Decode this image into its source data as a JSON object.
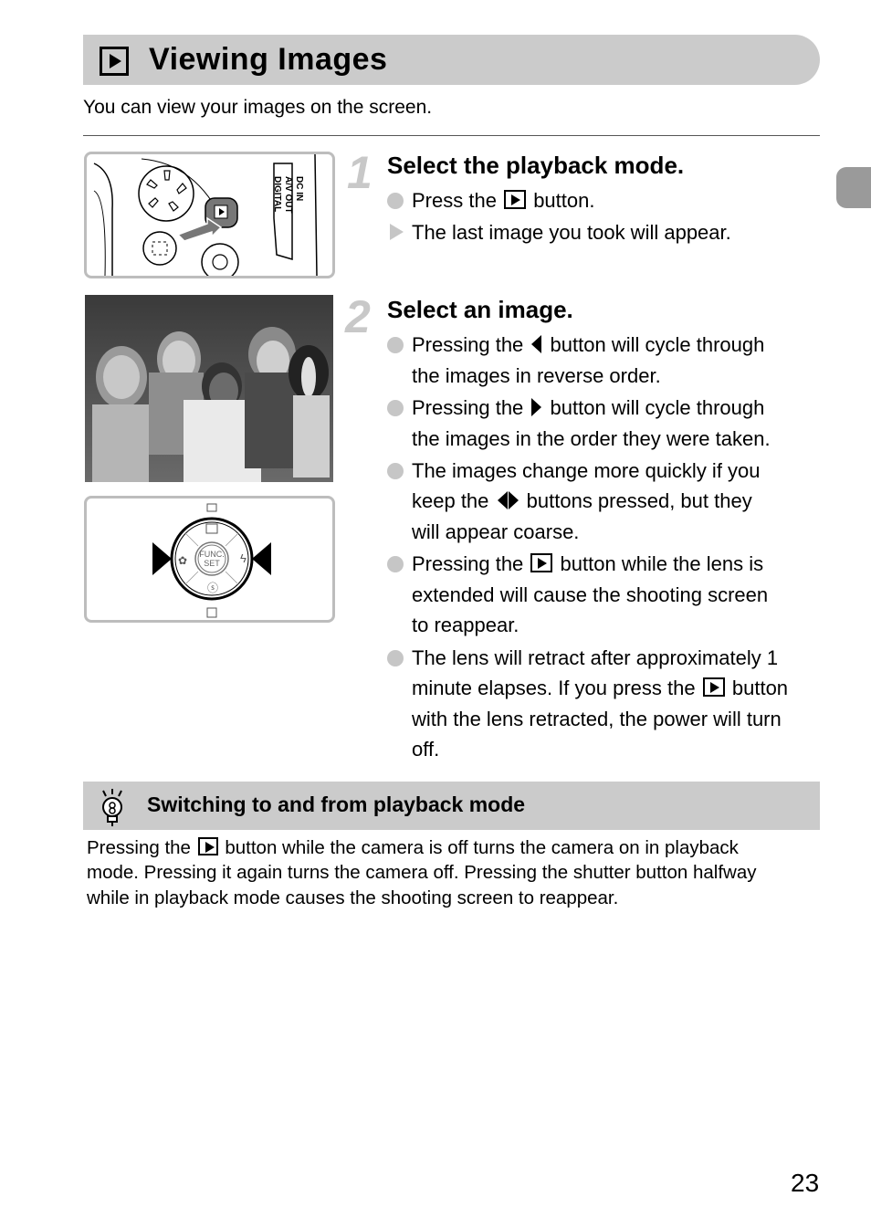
{
  "header": {
    "icon": "playback-icon",
    "title": "Viewing Images",
    "intro": "You can view your images on the screen."
  },
  "figures": {
    "camera_back": {
      "description": "Camera back with arrow pointing at playback button",
      "port_label": [
        "DC IN",
        "A/V OUT",
        "DIGITAL"
      ]
    },
    "photo": {
      "description": "Grayscale photo of four smiling children and a dog"
    },
    "control_dial": {
      "center_label": [
        "FUNC.",
        "SET"
      ]
    }
  },
  "steps": [
    {
      "number": "1",
      "title": "Select the playback mode.",
      "lines": [
        {
          "pre": "Press the",
          "post": "button."
        },
        {
          "text": "The last image you took will appear."
        }
      ]
    },
    {
      "number": "2",
      "title": "Select an image.",
      "bullets": [
        [
          "Pressing the",
          "button will cycle through",
          "the images in reverse order."
        ],
        [
          "Pressing the",
          "button will cycle through",
          "the images in the order they were taken."
        ],
        [
          "The images change more quickly if you",
          "keep the",
          "buttons pressed, but they",
          "will appear coarse."
        ],
        [
          "Pressing the",
          "button while the lens is",
          "extended will cause the shooting screen",
          "to reappear."
        ],
        [
          "The lens will retract after approximately 1",
          "minute elapses. If you press the",
          "button",
          "with the lens retracted, the power will turn",
          "off."
        ]
      ]
    }
  ],
  "tip": {
    "icon": "lightbulb-icon",
    "title": "Switching to and from playback mode",
    "lines": [
      {
        "pre": "Pressing the",
        "post": "button while the camera is off turns the camera on in playback"
      },
      {
        "text": "mode. Pressing it again turns the camera off. Pressing the shutter button halfway"
      },
      {
        "text": "while in playback mode causes the shooting screen to reappear."
      }
    ]
  },
  "page_number": "23"
}
